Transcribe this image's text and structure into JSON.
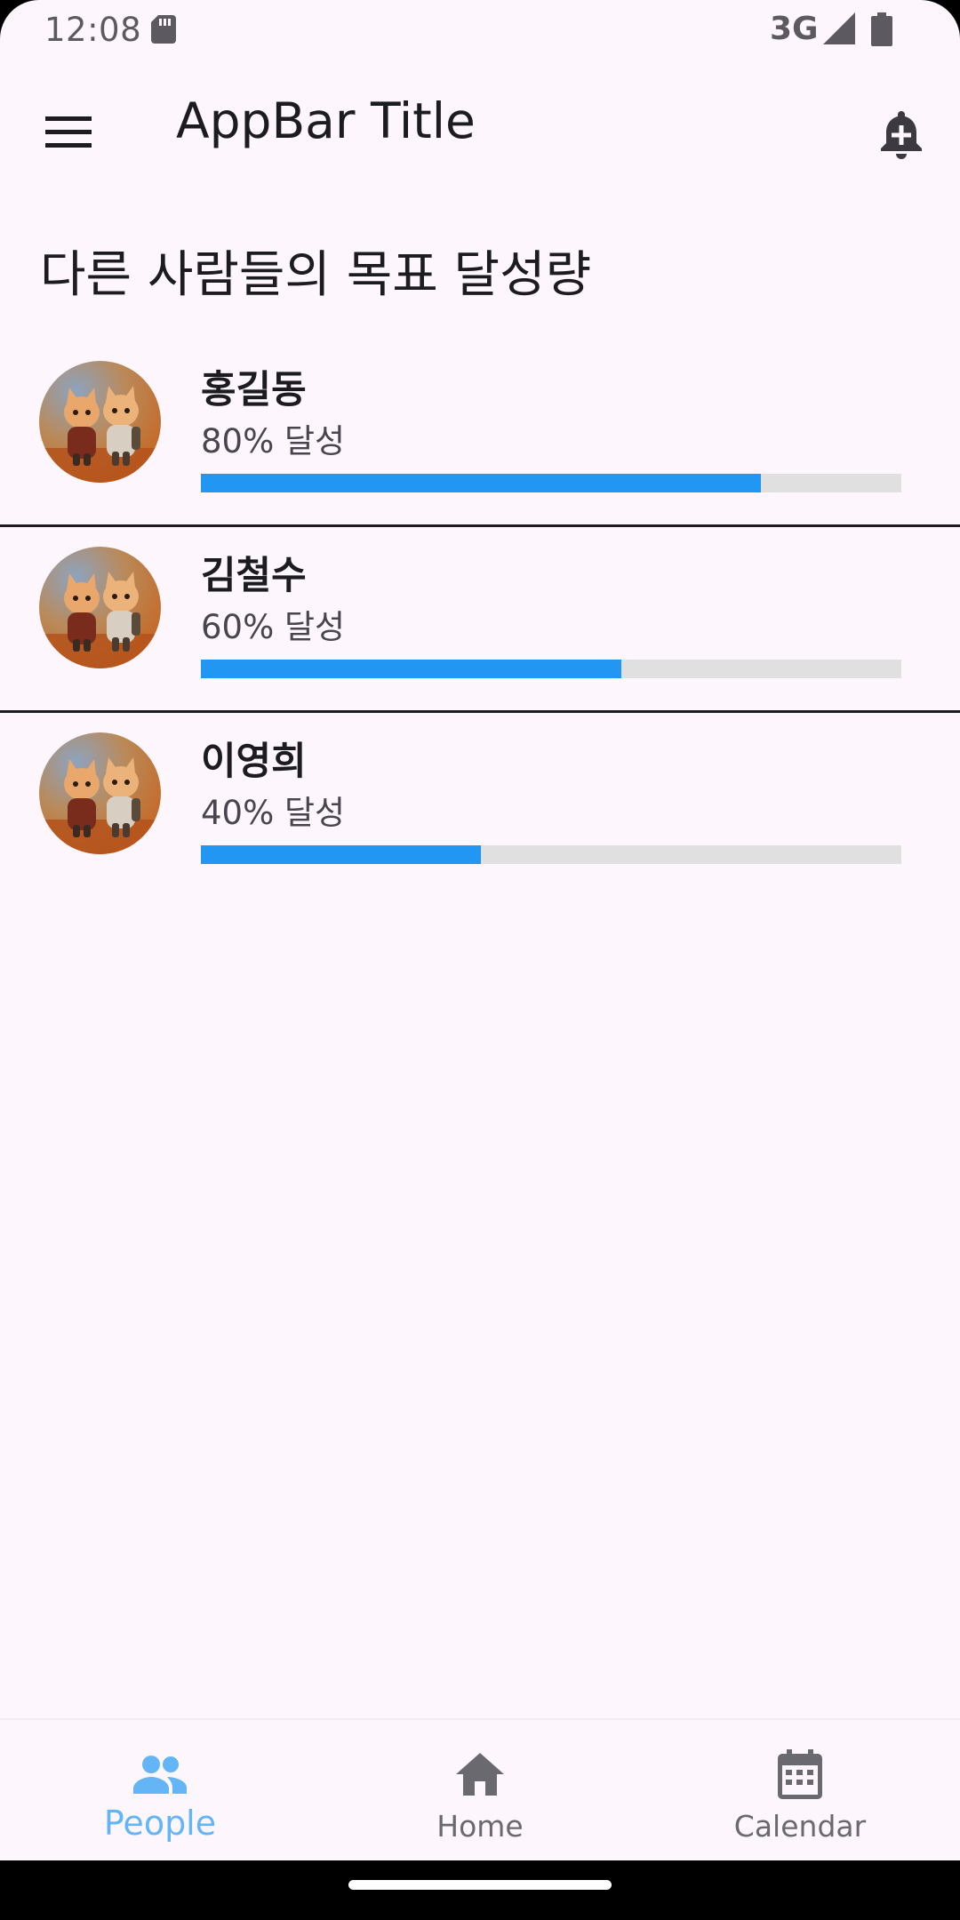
{
  "status_bar": {
    "time": "12:08",
    "network": "3G",
    "icons": [
      "sd-card-icon",
      "signal-icon",
      "battery-icon"
    ]
  },
  "app_bar": {
    "title": "AppBar Title",
    "menu_icon": "menu-icon",
    "action_icon": "notification-add-icon"
  },
  "page": {
    "heading": "다른 사람들의 목표 달성량"
  },
  "people": [
    {
      "name": "홍길동",
      "progress_text": "80% 달성",
      "progress": 0.8
    },
    {
      "name": "김철수",
      "progress_text": "60% 달성",
      "progress": 0.6
    },
    {
      "name": "이영희",
      "progress_text": "40% 달성",
      "progress": 0.4
    }
  ],
  "bottom_nav": {
    "items": [
      {
        "label": "People",
        "icon": "people-icon",
        "active": true
      },
      {
        "label": "Home",
        "icon": "home-icon",
        "active": false
      },
      {
        "label": "Calendar",
        "icon": "calendar-icon",
        "active": false
      }
    ]
  },
  "colors": {
    "background": "#FDF7FD",
    "progress_fill": "#2196F3",
    "progress_track": "#E0E0E0",
    "active_nav": "#64B5F6",
    "inactive_nav": "#6B6970"
  }
}
